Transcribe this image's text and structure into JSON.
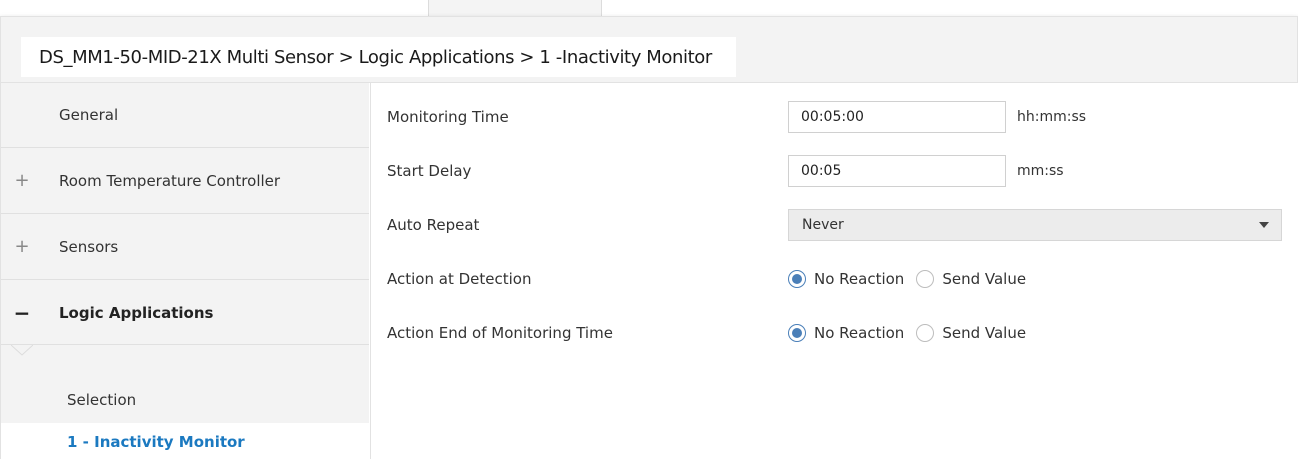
{
  "breadcrumb": {
    "text": "DS_MM1-50-MID-21X Multi Sensor > Logic Applications > 1 -Inactivity Monitor"
  },
  "sidebar": {
    "items": [
      {
        "label": "General",
        "toggle": ""
      },
      {
        "label": "Room Temperature Controller",
        "toggle": "+"
      },
      {
        "label": "Sensors",
        "toggle": "+"
      },
      {
        "label": "Logic Applications",
        "toggle": "−"
      }
    ],
    "subitems": [
      {
        "label": "Selection"
      },
      {
        "label": "1 - Inactivity Monitor"
      }
    ]
  },
  "parameters": {
    "monitoring_time": {
      "label": "Monitoring Time",
      "value": "00:05:00",
      "unit": "hh:mm:ss"
    },
    "start_delay": {
      "label": "Start Delay",
      "value": "00:05",
      "unit": "mm:ss"
    },
    "auto_repeat": {
      "label": "Auto Repeat",
      "value": "Never"
    },
    "action_at_detection": {
      "label": "Action at Detection",
      "options": [
        "No Reaction",
        "Send Value"
      ],
      "selected": "No Reaction"
    },
    "action_end": {
      "label": "Action End of Monitoring Time",
      "options": [
        "No Reaction",
        "Send Value"
      ],
      "selected": "No Reaction"
    }
  },
  "colors": {
    "accent": "#1b79c0",
    "radio_selected": "#4a7fb8",
    "panel_bg": "#f3f3f3"
  },
  "icons": {
    "expand": "plus-icon",
    "collapse": "minus-icon",
    "dropdown": "chevron-down-icon"
  }
}
